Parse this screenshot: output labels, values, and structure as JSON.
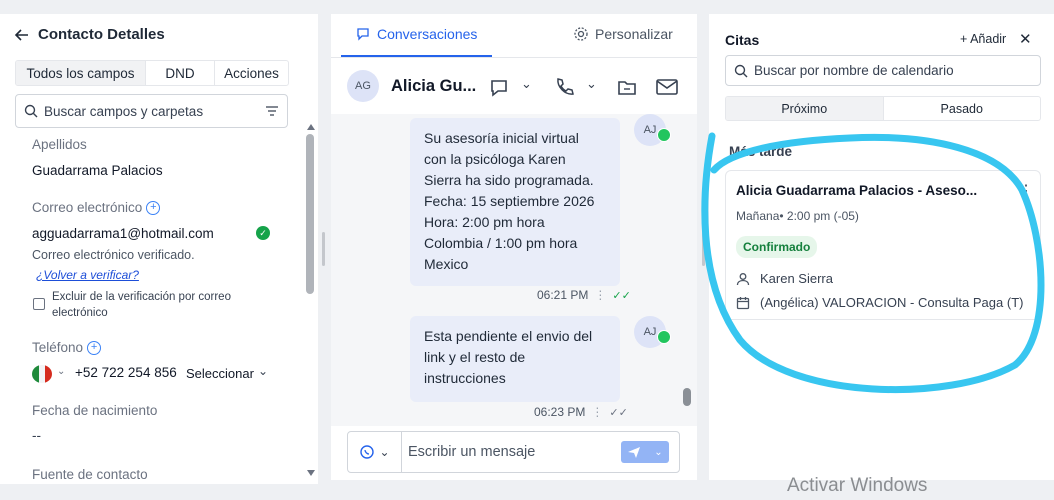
{
  "left_panel": {
    "title": "Contacto Detalles",
    "tabs": [
      "Todos los campos",
      "DND",
      "Acciones"
    ],
    "search_placeholder": "Buscar campos y carpetas",
    "fields": {
      "apellidos_label": "Apellidos",
      "apellidos_value": "Guadarrama Palacios",
      "email_label": "Correo electrónico",
      "email_value": "agguadarrama1@hotmail.com",
      "email_verified_text": "Correo electrónico verificado.",
      "reverify_link": "¿Volver a verificar?",
      "exclude_label": "Excluir de la verificación por correo electrónico",
      "phone_label": "Teléfono",
      "phone_value": "+52 722 254 856",
      "phone_select": "Seleccionar",
      "birth_label": "Fecha de nacimiento",
      "birth_value": "--",
      "source_label": "Fuente de contacto"
    }
  },
  "middle_panel": {
    "tabs": [
      "Conversaciones",
      "Personalizar"
    ],
    "contact_initials": "AG",
    "contact_name": "Alicia Gu...",
    "messages": [
      {
        "text": "Su asesoría inicial virtual\ncon la psicóloga Karen\nSierra ha sido programada.\nFecha: 15 septiembre 2026\nHora: 2:00 pm hora\nColombia / 1:00 pm hora\nMexico",
        "time": "06:21 PM",
        "avatar": "AJ"
      },
      {
        "text": "Esta pendiente el envio del\nlink y el resto de\ninstrucciones",
        "time": "06:23 PM",
        "avatar": "AJ"
      }
    ],
    "composer_placeholder": "Escribir un mensaje"
  },
  "right_panel": {
    "title": "Citas",
    "add_label": "+ Añadir",
    "close_label": "✕",
    "search_placeholder": "Buscar por nombre de calendario",
    "tabs": [
      "Próximo",
      "Pasado"
    ],
    "section": "Más tarde",
    "appointment": {
      "title": "Alicia Guadarrama Palacios - Aseso...",
      "time": "Mañana• 2:00 pm (-05)",
      "status": "Confirmado",
      "person": "Karen Sierra",
      "calendar": "(Angélica) VALORACION - Consulta Paga (T)"
    }
  },
  "watermark": "Activar Windows",
  "colors": {
    "accent": "#2563eb",
    "highlight": "#38c6f0",
    "status_green": "#15803d"
  }
}
